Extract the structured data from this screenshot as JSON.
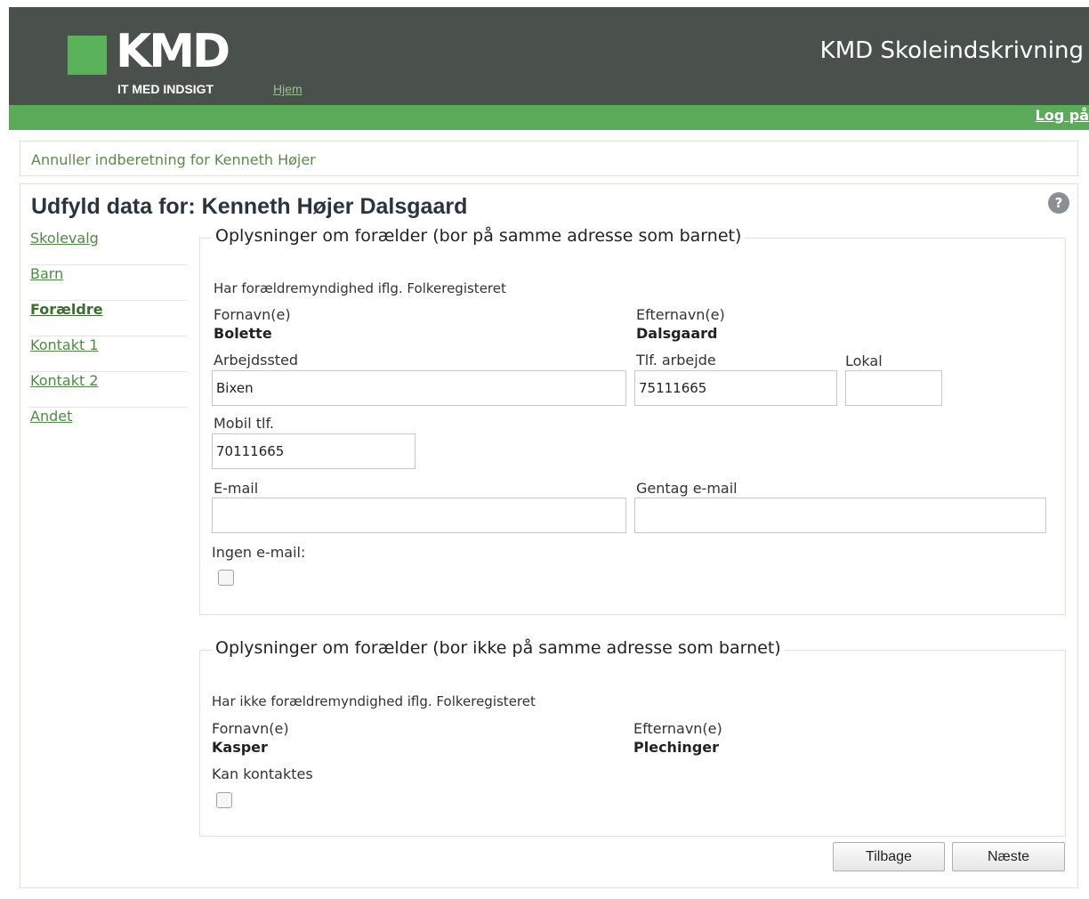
{
  "header": {
    "logo_text": "KMD",
    "tagline": "IT MED INDSIGT",
    "home_link": "Hjem",
    "app_title": "KMD Skoleindskrivning",
    "login_link": "Log på"
  },
  "cancel_link": "Annuller indberetning for Kenneth Højer",
  "page_title": "Udfyld data for: Kenneth Højer Dalsgaard",
  "help_icon": "?",
  "sidebar": {
    "items": [
      {
        "label": "Skolevalg"
      },
      {
        "label": "Barn"
      },
      {
        "label": "Forældre",
        "active": true
      },
      {
        "label": "Kontakt 1"
      },
      {
        "label": "Kontakt 2"
      },
      {
        "label": "Andet"
      }
    ]
  },
  "parent1": {
    "legend": "Oplysninger om forælder (bor på samme adresse som barnet)",
    "note": "Har forældremyndighed iflg. Folkeregisteret",
    "firstname_label": "Fornavn(e)",
    "firstname": "Bolette",
    "lastname_label": "Efternavn(e)",
    "lastname": "Dalsgaard",
    "workplace_label": "Arbejdssted",
    "workplace": "Bixen",
    "work_phone_label": "Tlf. arbejde",
    "work_phone": "75111665",
    "extension_label": "Lokal",
    "extension": "",
    "mobile_label": "Mobil tlf.",
    "mobile": "70111665",
    "email_label": "E-mail",
    "email": "",
    "email_repeat_label": "Gentag e-mail",
    "email_repeat": "",
    "no_email_label": "Ingen e-mail:",
    "no_email_checked": false
  },
  "parent2": {
    "legend": "Oplysninger om forælder (bor ikke på samme adresse som barnet)",
    "note": "Har ikke forældremyndighed iflg. Folkeregisteret",
    "firstname_label": "Fornavn(e)",
    "firstname": "Kasper",
    "lastname_label": "Efternavn(e)",
    "lastname": "Plechinger",
    "contactable_label": "Kan kontaktes",
    "contactable_checked": false
  },
  "buttons": {
    "back": "Tilbage",
    "next": "Næste"
  }
}
